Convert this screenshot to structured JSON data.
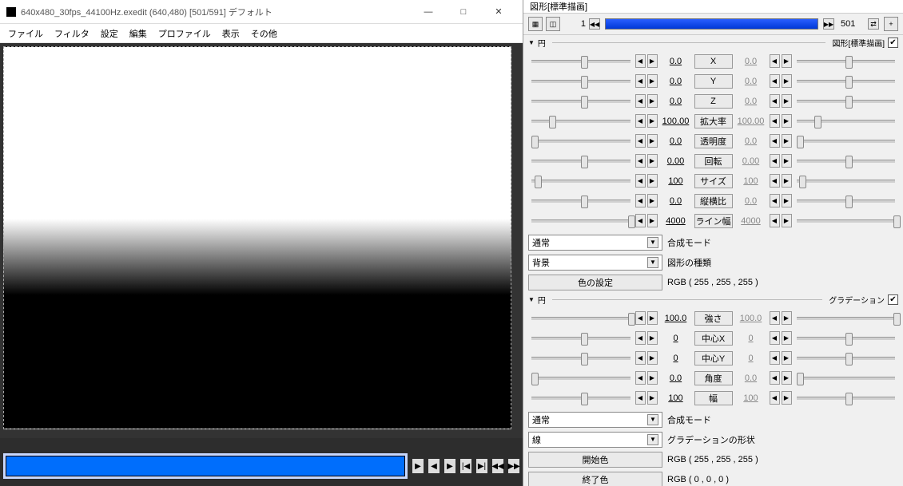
{
  "left": {
    "title": "640x480_30fps_44100Hz.exedit (640,480)  [501/591]  デフォルト",
    "win_min": "—",
    "win_max": "□",
    "win_close": "✕",
    "menu": [
      "ファイル",
      "フィルタ",
      "設定",
      "編集",
      "プロファイル",
      "表示",
      "その他"
    ]
  },
  "right": {
    "title": "図形[標準描画]",
    "frame_cur": "1",
    "frame_total": "501",
    "sections": [
      {
        "head_left": "円",
        "head_right": "図形[標準描画]",
        "check": "✔",
        "params": [
          {
            "label": "X",
            "l": "0.0",
            "r": "0.0",
            "lk": 50,
            "rk": 50
          },
          {
            "label": "Y",
            "l": "0.0",
            "r": "0.0",
            "lk": 50,
            "rk": 50
          },
          {
            "label": "Z",
            "l": "0.0",
            "r": "0.0",
            "lk": 50,
            "rk": 50
          },
          {
            "label": "拡大率",
            "l": "100.00",
            "r": "100.00",
            "lk": 18,
            "rk": 18
          },
          {
            "label": "透明度",
            "l": "0.0",
            "r": "0.0",
            "lk": 0,
            "rk": 0
          },
          {
            "label": "回転",
            "l": "0.00",
            "r": "0.00",
            "lk": 50,
            "rk": 50
          },
          {
            "label": "サイズ",
            "l": "100",
            "r": "100",
            "lk": 3,
            "rk": 3
          },
          {
            "label": "縦横比",
            "l": "0.0",
            "r": "0.0",
            "lk": 50,
            "rk": 50
          },
          {
            "label": "ライン幅",
            "l": "4000",
            "r": "4000",
            "lk": 98,
            "rk": 98
          }
        ],
        "select1": {
          "value": "通常",
          "label": "合成モード"
        },
        "select2": {
          "value": "背景",
          "label": "図形の種類"
        },
        "btn": {
          "label": "色の設定",
          "rgb": "RGB ( 255 , 255 , 255 )"
        }
      },
      {
        "head_left": "円",
        "head_right": "グラデーション",
        "check": "✔",
        "params": [
          {
            "label": "強さ",
            "l": "100.0",
            "r": "100.0",
            "lk": 98,
            "rk": 98
          },
          {
            "label": "中心X",
            "l": "0",
            "r": "0",
            "lk": 50,
            "rk": 50
          },
          {
            "label": "中心Y",
            "l": "0",
            "r": "0",
            "lk": 50,
            "rk": 50
          },
          {
            "label": "角度",
            "l": "0.0",
            "r": "0.0",
            "lk": 0,
            "rk": 0
          },
          {
            "label": "幅",
            "l": "100",
            "r": "100",
            "lk": 50,
            "rk": 50
          }
        ],
        "select1": {
          "value": "通常",
          "label": "合成モード"
        },
        "select2": {
          "value": "線",
          "label": "グラデーションの形状"
        },
        "btn": {
          "label": "開始色",
          "rgb": "RGB ( 255 , 255 , 255 )"
        },
        "btn2": {
          "label": "終了色",
          "rgb": "RGB ( 0 , 0 , 0 )"
        }
      }
    ]
  }
}
